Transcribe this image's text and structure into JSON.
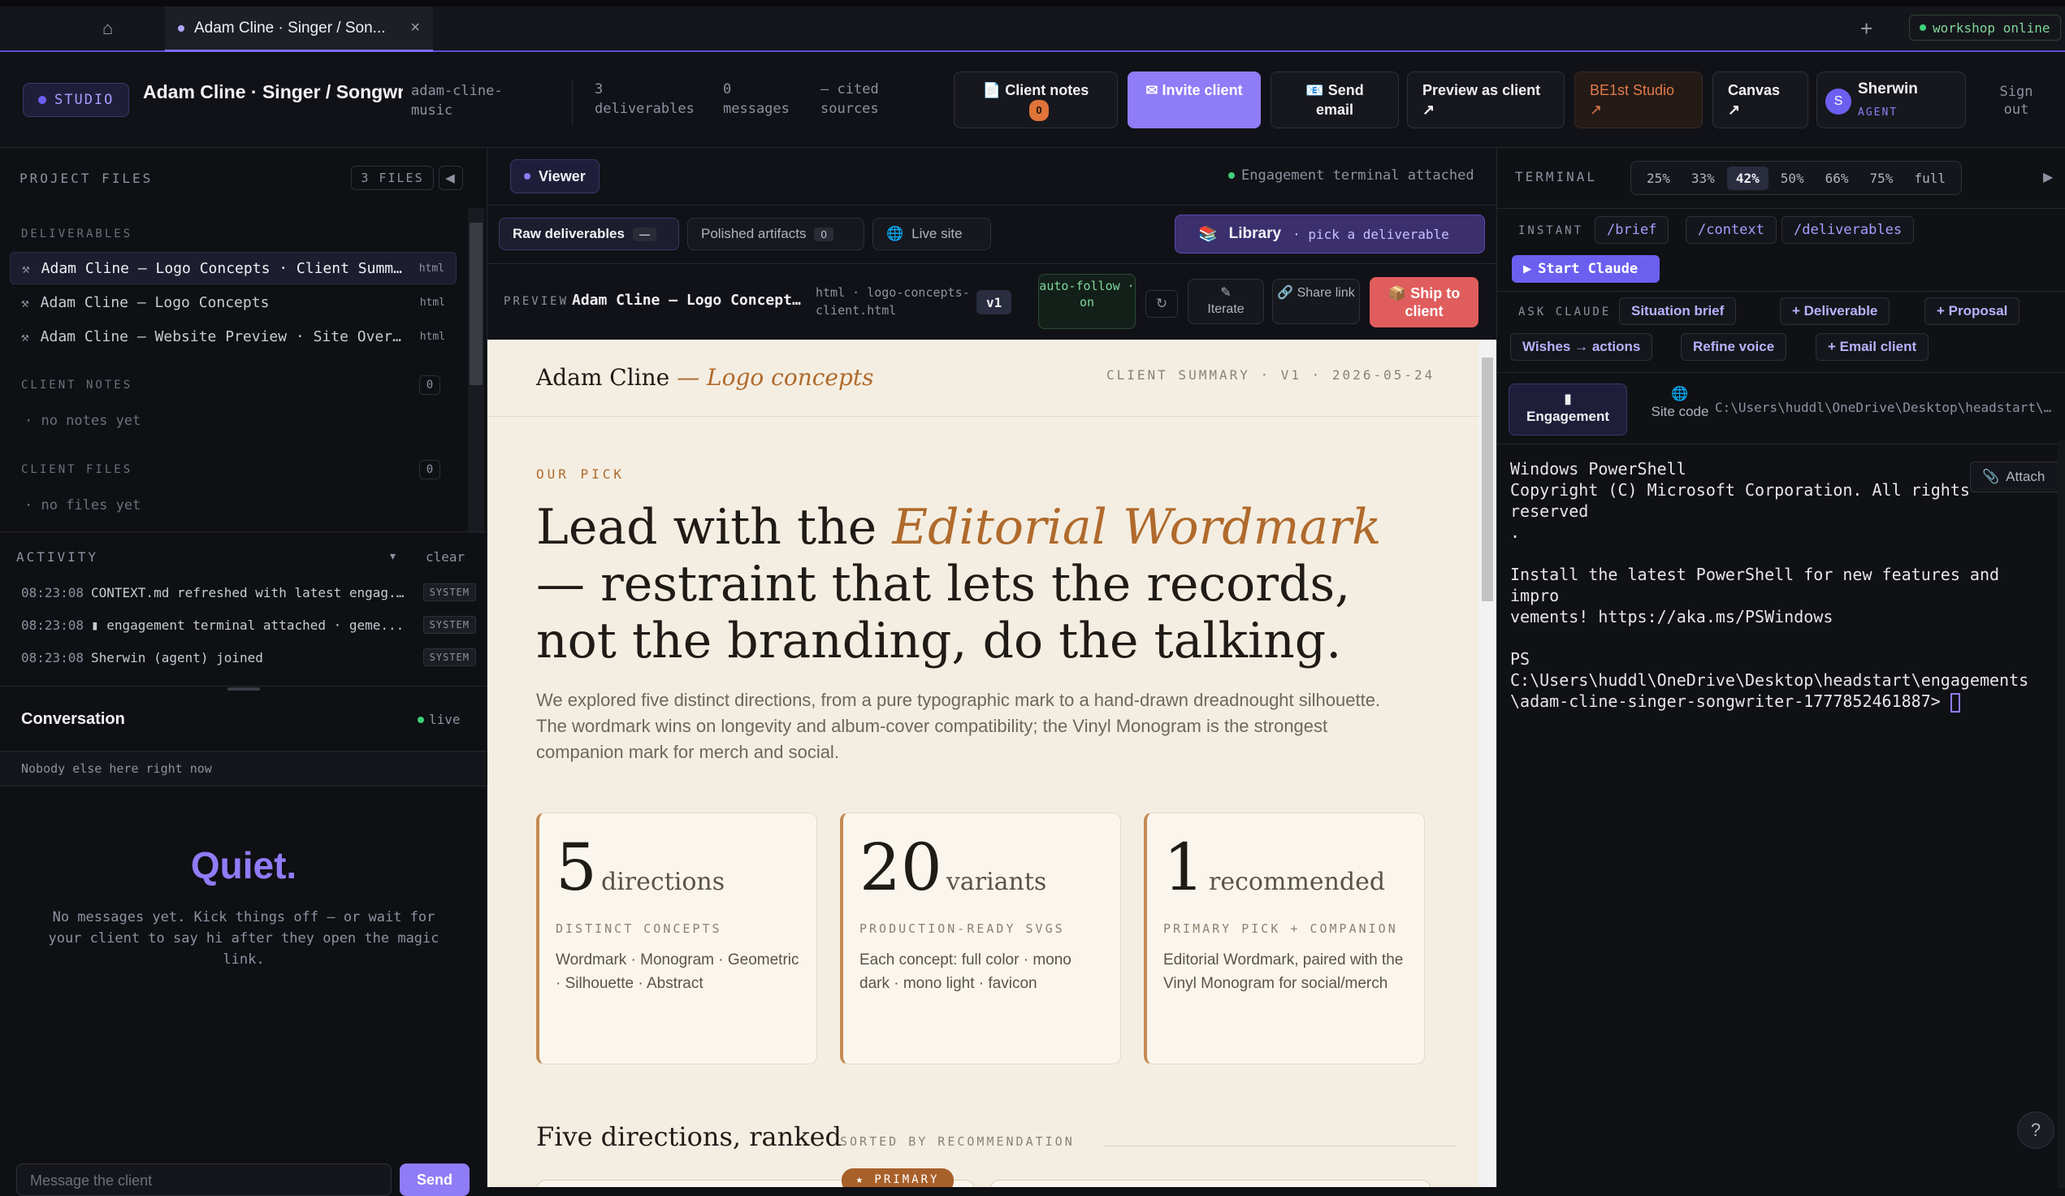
{
  "tabbar": {
    "tab_title": "Adam Cline · Singer / Son...",
    "online_label": "workshop online",
    "plus": "+",
    "close": "×"
  },
  "header": {
    "studio_label": "STUDIO",
    "project_title": "Adam Cline · Singer / Songwr...",
    "project_slug": "adam-cline-music",
    "stats": [
      {
        "value": "3",
        "label": "deliverables"
      },
      {
        "value": "0",
        "label": "messages"
      },
      {
        "value": "—",
        "label": "cited sources"
      }
    ],
    "client_notes_label": "Client notes",
    "client_notes_count": "0",
    "invite_label": "Invite client",
    "send_email_label": "Send email",
    "preview_label": "Preview as client",
    "be1st_label": "BE1st Studio",
    "canvas_label": "Canvas",
    "arrow": "↗",
    "user_initial": "S",
    "user_name": "Sherwin",
    "user_role": "AGENT",
    "signout_label": "Sign out"
  },
  "left": {
    "files_title": "PROJECT FILES",
    "files_count": "3 FILES",
    "deliverables_label": "DELIVERABLES",
    "files": [
      {
        "name": "Adam Cline — Logo Concepts · Client Summa...",
        "type": "html"
      },
      {
        "name": "Adam Cline — Logo Concepts",
        "type": "html"
      },
      {
        "name": "Adam Cline — Website Preview · Site Overv...",
        "type": "html"
      }
    ],
    "client_notes_label": "CLIENT NOTES",
    "client_notes_count": "0",
    "no_notes": "· no notes yet",
    "client_files_label": "CLIENT FILES",
    "client_files_count": "0",
    "no_files": "· no files yet",
    "activity_label": "ACTIVITY",
    "clear_label": "clear",
    "activity": [
      {
        "time": "08:23:08",
        "text": "CONTEXT.md refreshed with latest engag...",
        "tag": "SYSTEM"
      },
      {
        "time": "08:23:08",
        "text": "engagement terminal attached · geme...",
        "tag": "SYSTEM"
      },
      {
        "time": "08:23:08",
        "text": "Sherwin (agent) joined",
        "tag": "SYSTEM"
      }
    ],
    "conversation_title": "Conversation",
    "live_label": "live",
    "nobody_label": "Nobody else here right now",
    "quiet_title": "Quiet.",
    "quiet_sub": "No messages yet. Kick things off — or wait for your client to say hi after they open the magic link.",
    "message_placeholder": "Message the client",
    "send_label": "Send"
  },
  "center": {
    "viewer_label": "Viewer",
    "terminal_attached": "Engagement terminal attached",
    "raw_label": "Raw deliverables",
    "raw_count": "—",
    "polished_label": "Polished artifacts",
    "polished_count": "0",
    "live_site_label": "Live site",
    "library_label": "Library",
    "library_sub": "· pick a deliverable",
    "preview_label": "PREVIEW",
    "preview_name": "Adam Cline — Logo Concepts...",
    "preview_file": "html · logo-concepts-client.html",
    "version": "v1",
    "autofollow": "auto-follow · on",
    "refresh": "↻",
    "iterate_label": "Iterate",
    "share_label": "Share link",
    "ship_label": "Ship to client"
  },
  "doc": {
    "brand_name": "Adam Cline",
    "brand_suffix": "— Logo concepts",
    "meta": "CLIENT SUMMARY · V1 · 2026-05-24",
    "kicker": "OUR PICK",
    "headline_pre": "Lead with the ",
    "headline_em": "Editorial Wordmark",
    "headline_post": " — restraint that lets the records, not the branding, do the talking.",
    "lead": "We explored five distinct directions, from a pure typographic mark to a hand-drawn dreadnought silhouette. The wordmark wins on longevity and album-cover compatibility; the Vinyl Monogram is the strongest companion mark for merch and social.",
    "cards": [
      {
        "num": "5",
        "unit": "directions",
        "label": "DISTINCT CONCEPTS",
        "desc": "Wordmark · Monogram · Geometric · Silhouette · Abstract"
      },
      {
        "num": "20",
        "unit": "variants",
        "label": "PRODUCTION-READY SVGS",
        "desc": "Each concept: full color · mono dark · mono light · favicon"
      },
      {
        "num": "1",
        "unit": "recommended",
        "label": "PRIMARY PICK + COMPANION",
        "desc": "Editorial Wordmark, paired with the Vinyl Monogram for social/merch"
      }
    ],
    "section_title": "Five directions, ranked",
    "sorted_label": "SORTED BY RECOMMENDATION",
    "primary_tag": "★ PRIMARY"
  },
  "right": {
    "terminal_label": "TERMINAL",
    "zooms": [
      "25%",
      "33%",
      "42%",
      "50%",
      "66%",
      "75%",
      "full"
    ],
    "zoom_active": "42%",
    "collapse": "▶",
    "instant_label": "INSTANT",
    "instant_cmds": [
      "/brief",
      "/context",
      "/deliverables"
    ],
    "start_label": "Start Claude",
    "ask_label": "ASK CLAUDE",
    "ask_cmds": [
      "Situation brief",
      "+ Deliverable",
      "+ Proposal",
      "Wishes → actions",
      "Refine voice",
      "+ Email client"
    ],
    "engagement_label": "Engagement",
    "site_code_label": "Site code",
    "path": "C:\\Users\\huddl\\OneDrive\\Desktop\\headstart\\...",
    "attach_label": "Attach",
    "terminal_lines": "Windows PowerShell\nCopyright (C) Microsoft Corporation. All rights reserved\n.\n\nInstall the latest PowerShell for new features and impro\nvements! https://aka.ms/PSWindows\n\nPS C:\\Users\\huddl\\OneDrive\\Desktop\\headstart\\engagements\n\\adam-cline-singer-songwriter-1777852461887> ",
    "help": "?"
  }
}
